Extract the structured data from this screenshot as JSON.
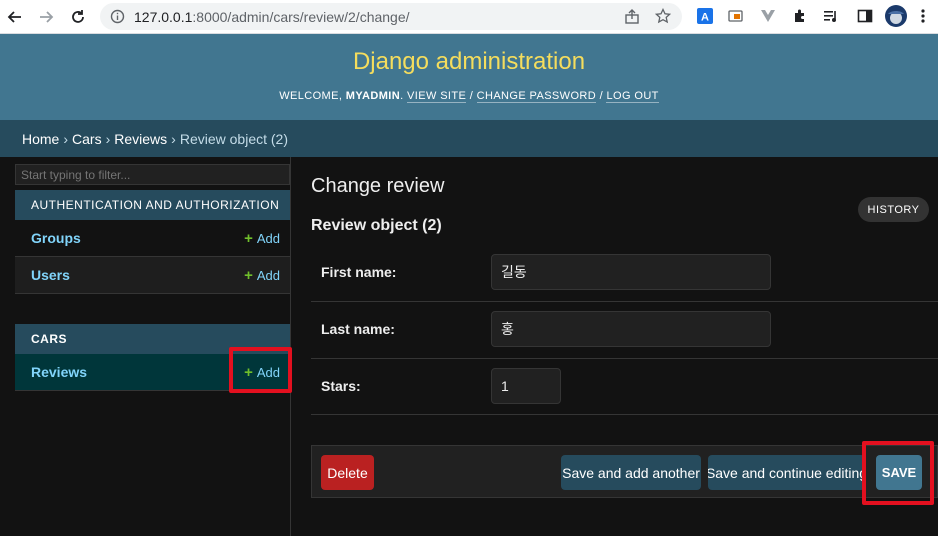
{
  "browser": {
    "url_host": "127.0.0.1",
    "url_path": ":8000/admin/cars/review/2/change/"
  },
  "header": {
    "site_title": "Django administration",
    "welcome": "WELCOME,",
    "username": "MYADMIN",
    "view_site": "VIEW SITE",
    "change_password": "CHANGE PASSWORD",
    "log_out": "LOG OUT"
  },
  "breadcrumbs": {
    "home": "Home",
    "app": "Cars",
    "model": "Reviews",
    "current": "Review object (2)",
    "separator": "›"
  },
  "sidebar": {
    "filter_placeholder": "Start typing to filter...",
    "auth_caption": "AUTHENTICATION AND AUTHORIZATION",
    "auth_models": [
      {
        "name": "Groups",
        "add": "Add"
      },
      {
        "name": "Users",
        "add": "Add"
      }
    ],
    "cars_caption": "CARS",
    "cars_models": [
      {
        "name": "Reviews",
        "add": "Add"
      }
    ]
  },
  "main": {
    "page_title": "Change review",
    "history": "HISTORY",
    "object_title": "Review object (2)",
    "fields": {
      "first_name_label": "First name:",
      "first_name_value": "길동",
      "last_name_label": "Last name:",
      "last_name_value": "홍",
      "stars_label": "Stars:",
      "stars_value": "1"
    },
    "buttons": {
      "delete": "Delete",
      "save_add_another": "Save and add another",
      "save_continue": "Save and continue editing",
      "save": "SAVE"
    }
  },
  "colors": {
    "header_bg": "#417690",
    "site_title": "#f5dd5d",
    "breadcrumb_bg": "#264b5d",
    "link": "#81d4fa",
    "delete": "#ba2121",
    "highlight": "#e3101f"
  }
}
